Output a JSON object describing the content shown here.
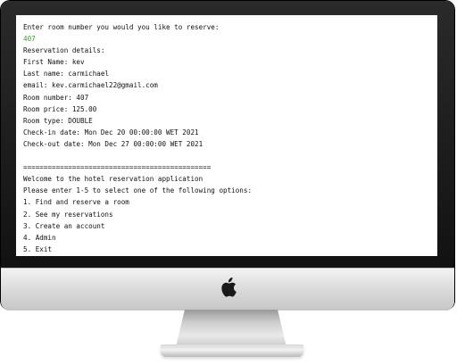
{
  "console": {
    "lines": [
      {
        "text": "Enter room number you would you like to reserve:",
        "kind": "output"
      },
      {
        "text": "407",
        "kind": "input"
      },
      {
        "text": "Reservation details:",
        "kind": "output"
      },
      {
        "text": "First Name: kev",
        "kind": "output"
      },
      {
        "text": "Last name: carmichael",
        "kind": "output"
      },
      {
        "text": "email: kev.carmichael22@gmail.com",
        "kind": "output"
      },
      {
        "text": "Room number: 407",
        "kind": "output"
      },
      {
        "text": "Room price: 125.00",
        "kind": "output"
      },
      {
        "text": "Room type: DOUBLE",
        "kind": "output"
      },
      {
        "text": "Check-in date: Mon Dec 20 00:00:00 WET 2021",
        "kind": "output"
      },
      {
        "text": "Check-out date: Mon Dec 27 00:00:00 WET 2021",
        "kind": "output"
      },
      {
        "text": "",
        "kind": "output"
      },
      {
        "text": "==============================================",
        "kind": "output"
      },
      {
        "text": "Welcome to the hotel reservation application",
        "kind": "output"
      },
      {
        "text": "Please enter 1-5 to select one of the following options:",
        "kind": "output"
      },
      {
        "text": "1. Find and reserve a room",
        "kind": "output"
      },
      {
        "text": "2. See my reservations",
        "kind": "output"
      },
      {
        "text": "3. Create an account",
        "kind": "output"
      },
      {
        "text": "4. Admin",
        "kind": "output"
      },
      {
        "text": "5. Exit",
        "kind": "output"
      }
    ]
  },
  "colors": {
    "input_text": "#3a9a36",
    "console_text": "#111111",
    "screen_background": "#ffffff"
  },
  "icons": {
    "logo": "apple-logo-icon"
  }
}
